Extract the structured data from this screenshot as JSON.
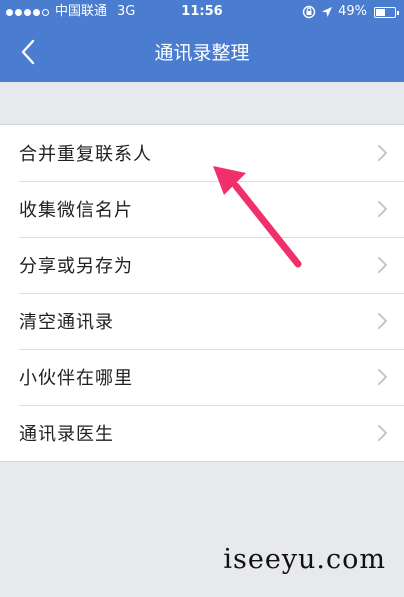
{
  "status_bar": {
    "carrier": "中国联通",
    "network": "3G",
    "time": "11:56",
    "battery": "49%",
    "battery_level": 0.49
  },
  "nav": {
    "title": "通讯录整理",
    "back_icon": "chevron-left-icon"
  },
  "menu": {
    "items": [
      {
        "label": "合并重复联系人"
      },
      {
        "label": "收集微信名片"
      },
      {
        "label": "分享或另存为"
      },
      {
        "label": "清空通讯录"
      },
      {
        "label": "小伙伴在哪里"
      },
      {
        "label": "通讯录医生"
      }
    ]
  },
  "annotation": {
    "arrow_color": "#f0306a"
  },
  "watermark": "iseeyu.com",
  "colors": {
    "header": "#4a7ccf",
    "background": "#e7e9ed",
    "chevron": "#c4c6ca"
  }
}
